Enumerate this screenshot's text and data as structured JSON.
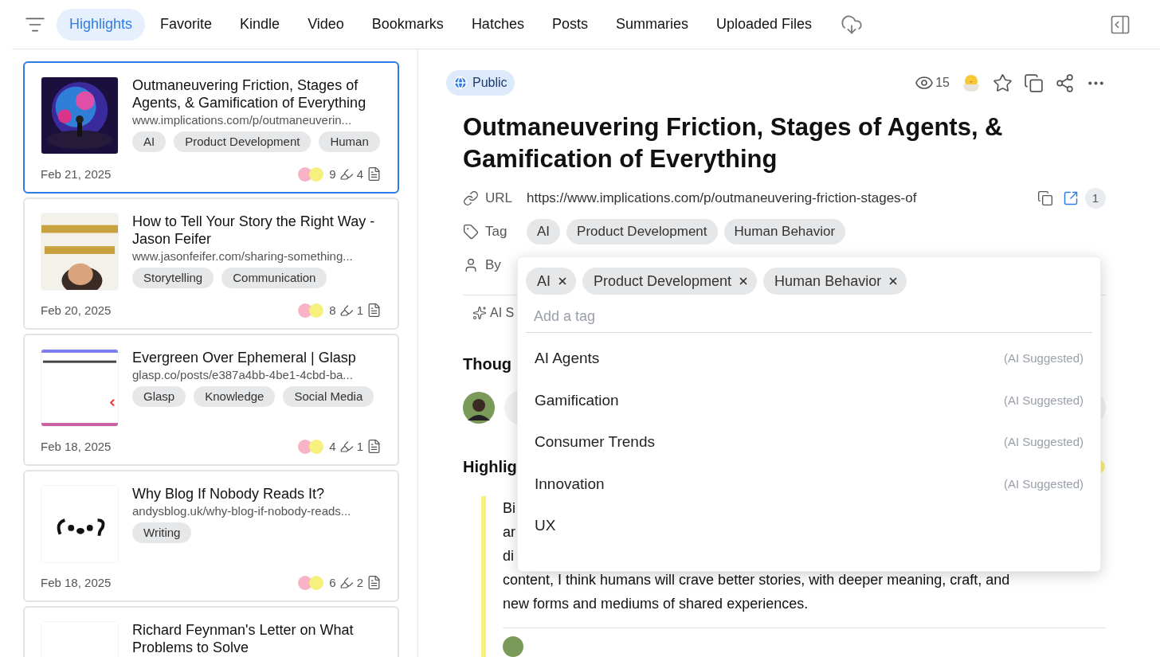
{
  "nav": {
    "tabs": [
      {
        "label": "Highlights",
        "selected": true
      },
      {
        "label": "Favorite",
        "selected": false
      },
      {
        "label": "Kindle",
        "selected": false
      },
      {
        "label": "Video",
        "selected": false
      },
      {
        "label": "Bookmarks",
        "selected": false
      },
      {
        "label": "Hatches",
        "selected": false
      },
      {
        "label": "Posts",
        "selected": false
      },
      {
        "label": "Summaries",
        "selected": false
      },
      {
        "label": "Uploaded Files",
        "selected": false
      }
    ]
  },
  "cards": [
    {
      "selected": true,
      "title": "Outmaneuvering Friction, Stages of Agents, & Gamification of Everything",
      "url": "www.implications.com/p/outmaneuverin...",
      "tags": [
        "AI",
        "Product Development",
        "Human"
      ],
      "date": "Feb 21, 2025",
      "highlights": "9",
      "notes": "4"
    },
    {
      "selected": false,
      "title": "How to Tell Your Story the Right Way - Jason Feifer",
      "url": "www.jasonfeifer.com/sharing-something...",
      "tags": [
        "Storytelling",
        "Communication"
      ],
      "date": "Feb 20, 2025",
      "highlights": "8",
      "notes": "1"
    },
    {
      "selected": false,
      "title": "Evergreen Over Ephemeral | Glasp",
      "url": "glasp.co/posts/e387a4bb-4be1-4cbd-ba...",
      "tags": [
        "Glasp",
        "Knowledge",
        "Social Media"
      ],
      "date": "Feb 18, 2025",
      "highlights": "4",
      "notes": "1"
    },
    {
      "selected": false,
      "title": "Why Blog If Nobody Reads It?",
      "url": "andysblog.uk/why-blog-if-nobody-reads...",
      "tags": [
        "Writing"
      ],
      "date": "Feb 18, 2025",
      "highlights": "6",
      "notes": "2"
    },
    {
      "selected": false,
      "title": "Richard Feynman's Letter on What Problems to Solve"
    }
  ],
  "detail": {
    "visibility": "Public",
    "views": "15",
    "title": "Outmaneuvering Friction, Stages of Agents, & Gamification of Everything",
    "url_label": "URL",
    "url": "https://www.implications.com/p/outmaneuvering-friction-stages-of",
    "url_count": "1",
    "tag_label": "Tag",
    "tags": [
      "AI",
      "Product Development",
      "Human Behavior"
    ],
    "by_label": "By",
    "ai_button": "AI S",
    "thoughts_heading": "Thoug",
    "highlights_heading": "Highlig",
    "highlight_lines": [
      "Bi",
      "ar",
      "di",
      "content, I think humans will crave better stories, with deeper meaning, craft, and",
      "new forms and mediums of shared experiences."
    ]
  },
  "tag_popup": {
    "chips": [
      "AI",
      "Product Development",
      "Human Behavior"
    ],
    "placeholder": "Add a tag",
    "suggestions": [
      {
        "label": "AI Agents",
        "note": "(AI Suggested)"
      },
      {
        "label": "Gamification",
        "note": "(AI Suggested)"
      },
      {
        "label": "Consumer Trends",
        "note": "(AI Suggested)"
      },
      {
        "label": "Innovation",
        "note": "(AI Suggested)"
      },
      {
        "label": "UX"
      }
    ]
  }
}
